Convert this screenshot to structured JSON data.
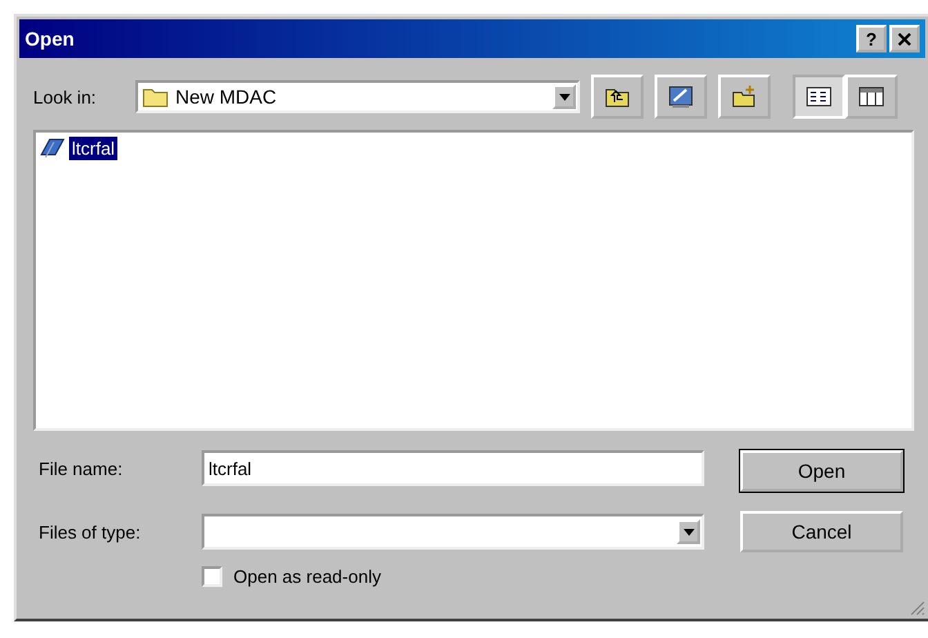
{
  "window": {
    "title": "Open",
    "help_button": "?"
  },
  "look_in": {
    "label": "Look in:",
    "value": "New MDAC"
  },
  "view_buttons": [
    {
      "kind": "list",
      "selected": true
    },
    {
      "kind": "details",
      "selected": false
    }
  ],
  "files": [
    {
      "name": "ltcrfal",
      "selected": true
    }
  ],
  "file_name": {
    "label": "File name:",
    "value": "ltcrfal"
  },
  "file_type": {
    "label": "Files of type:"
  },
  "read_only": {
    "label": "Open as read-only",
    "checked": false
  },
  "buttons": [
    "Open",
    "Cancel"
  ]
}
